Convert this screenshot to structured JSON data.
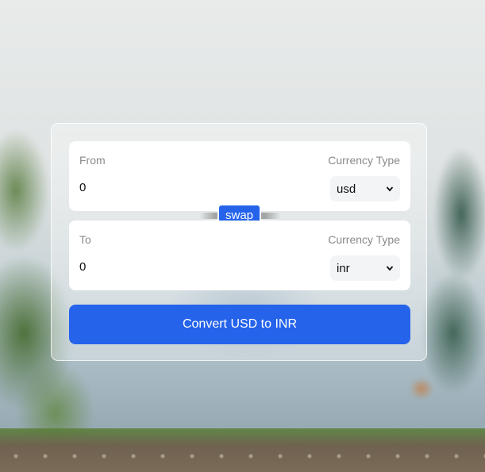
{
  "converter": {
    "from": {
      "label": "From",
      "currency_type_label": "Currency Type",
      "amount": "0",
      "selected_currency": "usd",
      "dropdown_icon": "chevron-down-icon"
    },
    "swap_label": "swap",
    "to": {
      "label": "To",
      "currency_type_label": "Currency Type",
      "amount": "0",
      "selected_currency": "inr",
      "dropdown_icon": "chevron-down-icon"
    },
    "convert_label": "Convert USD to INR"
  },
  "colors": {
    "accent": "#2563eb",
    "panel": "#ffffff",
    "select_bg": "#f3f4f6",
    "muted_text": "#8a8a8a"
  }
}
